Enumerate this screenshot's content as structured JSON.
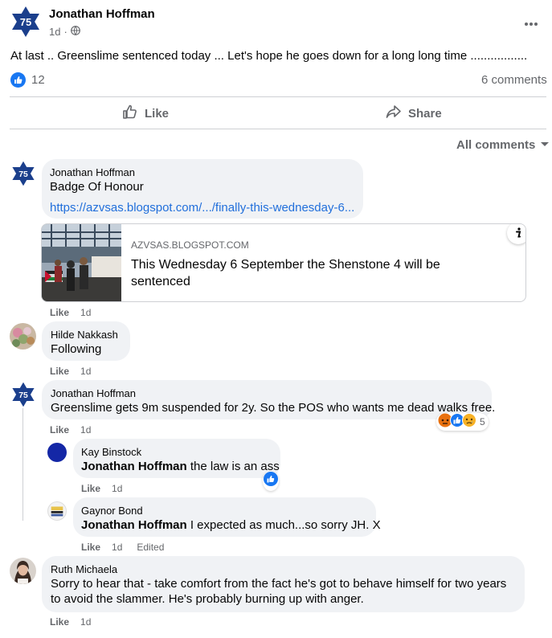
{
  "post": {
    "author": "Jonathan Hoffman",
    "avatar_text": "75",
    "time": "1d",
    "privacy_icon": "globe-icon",
    "text": "At last .. Greenslime sentenced today ... Let's hope he goes down for a long long time  .................",
    "reaction_count": "12",
    "comments_count": "6 comments"
  },
  "actions": {
    "like": "Like",
    "share": "Share"
  },
  "filter": {
    "label": "All comments"
  },
  "comments": [
    {
      "name": "Jonathan Hoffman",
      "text": "Badge Of Honour",
      "link": "https://azvsas.blogspot.com/.../finally-this-wednesday-6...",
      "preview_domain": "AZVSAS.BLOGSPOT.COM",
      "preview_title": "This Wednesday 6 September the Shenstone 4 will be sentenced",
      "like": "Like",
      "time": "1d"
    },
    {
      "name": "Hilde Nakkash",
      "text": "Following",
      "like": "Like",
      "time": "1d"
    },
    {
      "name": "Jonathan Hoffman",
      "text": "Greenslime gets 9m suspended for 2y. So the POS who wants me dead walks free.",
      "like": "Like",
      "time": "1d",
      "reaction_count": "5"
    },
    {
      "name": "Kay Binstock",
      "mention": "Jonathan Hoffman",
      "text": " the law is an ass",
      "like": "Like",
      "time": "1d"
    },
    {
      "name": "Gaynor Bond",
      "mention": "Jonathan Hoffman",
      "text": " I expected as much...so sorry JH. X",
      "like": "Like",
      "time": "1d",
      "edited": "Edited"
    },
    {
      "name": "Ruth Michaela",
      "text_line1": "Sorry to hear that - take comfort from the fact he's got to behave himself for two years",
      "text_line2": "to avoid the slammer. He's probably burning up with anger.",
      "like": "Like",
      "time": "1d"
    }
  ],
  "colors": {
    "brand_blue": "#1877f2",
    "star_blue": "#1b3f8c",
    "secondary_text": "#65676b",
    "bubble_bg": "#f0f2f5",
    "link": "#216fdb"
  }
}
